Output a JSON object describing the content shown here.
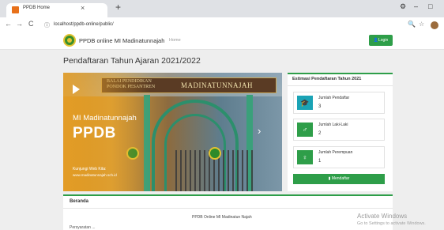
{
  "browser": {
    "tab_title": "PPDB Home",
    "tab_close": "×",
    "new_tab": "+",
    "url": "localhost/ppdb-online/public/",
    "icons": {
      "back": "←",
      "forward": "→",
      "reload": "C",
      "info": "ⓘ",
      "zoom": "🔍",
      "star": "☆"
    },
    "window": {
      "settings": "⚙",
      "minimize": "–",
      "maximize": "□"
    }
  },
  "site": {
    "brand": "PPDB online MI Madinatunnajah",
    "nav_home": "Home",
    "login_label": "Login",
    "accent_color": "#2e9e49"
  },
  "page": {
    "title": "Pendaftaran Tahun Ajaran 2021/2022"
  },
  "slider": {
    "banner_left": "BALAI PENDIDIKAN\nPONDOK PESANTREN",
    "banner_right": "MADINATUNNAJAH",
    "school_name": "MI Madinatunnajah",
    "headline": "PPDB",
    "visit_label": "Kunjungi Web Kita:",
    "visit_url": "www.madinatunnajah.sch.id",
    "next_arrow": "›"
  },
  "estimate": {
    "title": "Estimasi Pendaftaran Tahun 2021",
    "cards": [
      {
        "label": "Jumlah Pendaftar",
        "value": "3",
        "icon": "graduation-cap-icon",
        "color": "#1aa3b5",
        "glyph": "🎓"
      },
      {
        "label": "Jumlah Laki-Laki",
        "value": "2",
        "icon": "male-icon",
        "color": "#2e9e49",
        "glyph": "♂"
      },
      {
        "label": "Jumlah Perempuan",
        "value": "1",
        "icon": "female-icon",
        "color": "#2e9e49",
        "glyph": "♀"
      }
    ],
    "register_label": "Mendaftar"
  },
  "section": {
    "title": "Beranda",
    "text": "PPDB Online MI Madinatun Najah",
    "next_line": "Persyaratan ..."
  },
  "watermark": {
    "title": "Activate Windows",
    "subtitle": "Go to Settings to activate Windows."
  }
}
